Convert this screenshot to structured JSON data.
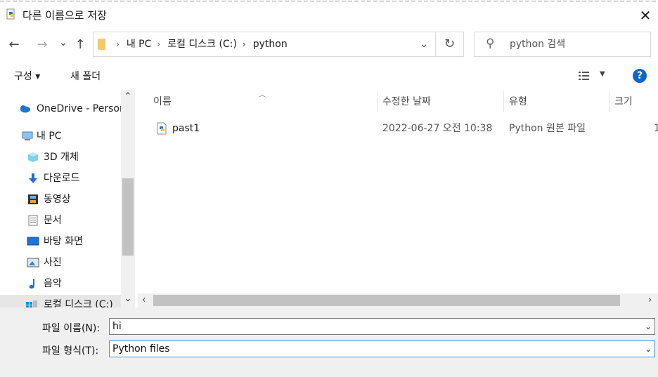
{
  "window": {
    "title": "다른 이름으로 저장",
    "close_glyph": "✕"
  },
  "nav": {
    "back": "←",
    "forward": "→",
    "recent": "⌄",
    "up": "↑"
  },
  "address": {
    "crumbs": [
      "내 PC",
      "로컬 디스크 (C:)",
      "python"
    ],
    "separator": "›",
    "dropdown": "⌄",
    "refresh": "↻"
  },
  "search": {
    "placeholder": "python 검색"
  },
  "toolbar": {
    "organize": "구성 ▾",
    "new_folder": "새 폴더",
    "help": "?"
  },
  "sidebar": {
    "items": [
      {
        "label": "OneDrive - Person",
        "icon": "cloud-icon"
      },
      {
        "label": "내 PC",
        "icon": "computer-icon"
      },
      {
        "label": "3D 개체",
        "icon": "cube-icon"
      },
      {
        "label": "다운로드",
        "icon": "download-icon"
      },
      {
        "label": "동영상",
        "icon": "film-icon"
      },
      {
        "label": "문서",
        "icon": "document-icon"
      },
      {
        "label": "바탕 화면",
        "icon": "desktop-icon"
      },
      {
        "label": "사진",
        "icon": "picture-icon"
      },
      {
        "label": "음악",
        "icon": "music-icon"
      },
      {
        "label": "로컬 디스크 (C:)",
        "icon": "drive-icon"
      }
    ]
  },
  "file_list": {
    "columns": [
      "이름",
      "수정한 날짜",
      "유형",
      "크기"
    ],
    "rows": [
      {
        "name": "past1",
        "modified": "2022-06-27 오전 10:38",
        "type": "Python 원본 파일",
        "size": "1"
      }
    ]
  },
  "scroll": {
    "up": "⌃",
    "down": "⌄",
    "left": "‹",
    "right": "›"
  },
  "form": {
    "filename_label": "파일 이름(N):",
    "filename_value": "hi",
    "filetype_label": "파일 형식(T):",
    "filetype_value": "Python files",
    "dropdown": "⌄"
  },
  "colors": {
    "accent": "#0a67c9",
    "folder": "#f3c969",
    "panel_bg": "#f0f0f0"
  }
}
